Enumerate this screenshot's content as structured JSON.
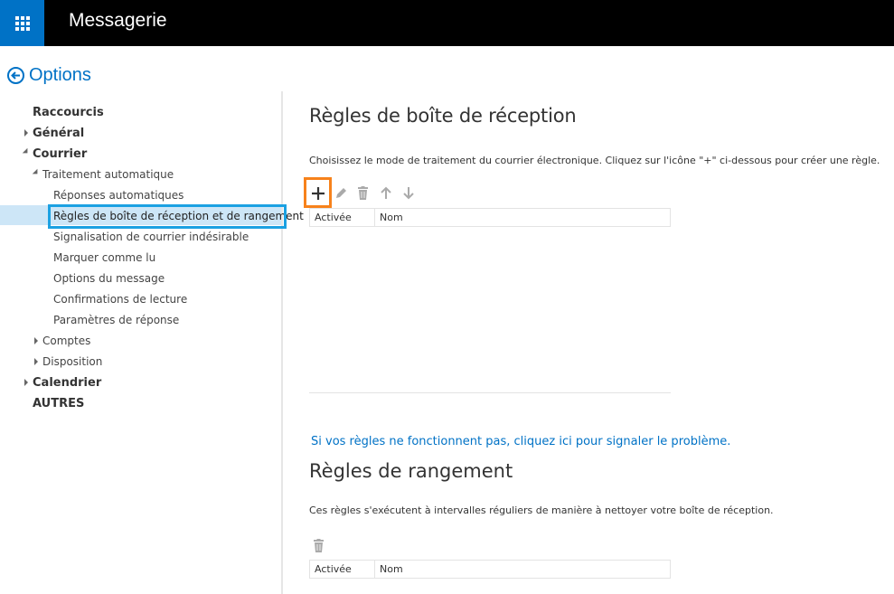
{
  "app": {
    "title": "Messagerie"
  },
  "header": {
    "options_label": "Options"
  },
  "sidebar": {
    "raccourcis": "Raccourcis",
    "general": "Général",
    "courrier": "Courrier",
    "traitement": "Traitement automatique",
    "reponses": "Réponses automatiques",
    "regles": "Règles de boîte de réception et de rangement",
    "signalisation": "Signalisation de courrier indésirable",
    "marquer": "Marquer comme lu",
    "options_message": "Options du message",
    "confirmations": "Confirmations de lecture",
    "parametres": "Paramètres de réponse",
    "comptes": "Comptes",
    "disposition": "Disposition",
    "calendrier": "Calendrier",
    "autres": "AUTRES"
  },
  "inbox_rules": {
    "title": "Règles de boîte de réception",
    "description": "Choisissez le mode de traitement du courrier électronique. Cliquez sur l'icône \"+\" ci-dessous pour créer une règle.",
    "columns": [
      "Activée",
      "Nom"
    ]
  },
  "report": {
    "link": "Si vos règles ne fonctionnent pas, cliquez ici pour signaler le problème."
  },
  "sweep_rules": {
    "title": "Règles de rangement",
    "description": "Ces règles s'exécutent à intervalles réguliers de manière à nettoyer votre boîte de réception.",
    "columns": [
      "Activée",
      "Nom"
    ]
  },
  "icons": [
    "app-launcher-icon",
    "back-arrow-icon",
    "plus-icon",
    "pencil-icon",
    "trash-icon",
    "arrow-up-icon",
    "arrow-down-icon"
  ],
  "colors": {
    "accent": "#0072c6",
    "topbar": "#000000",
    "highlight_orange": "#f7821b",
    "highlight_blue": "#1ba1e2",
    "selection": "#cde6f7"
  }
}
